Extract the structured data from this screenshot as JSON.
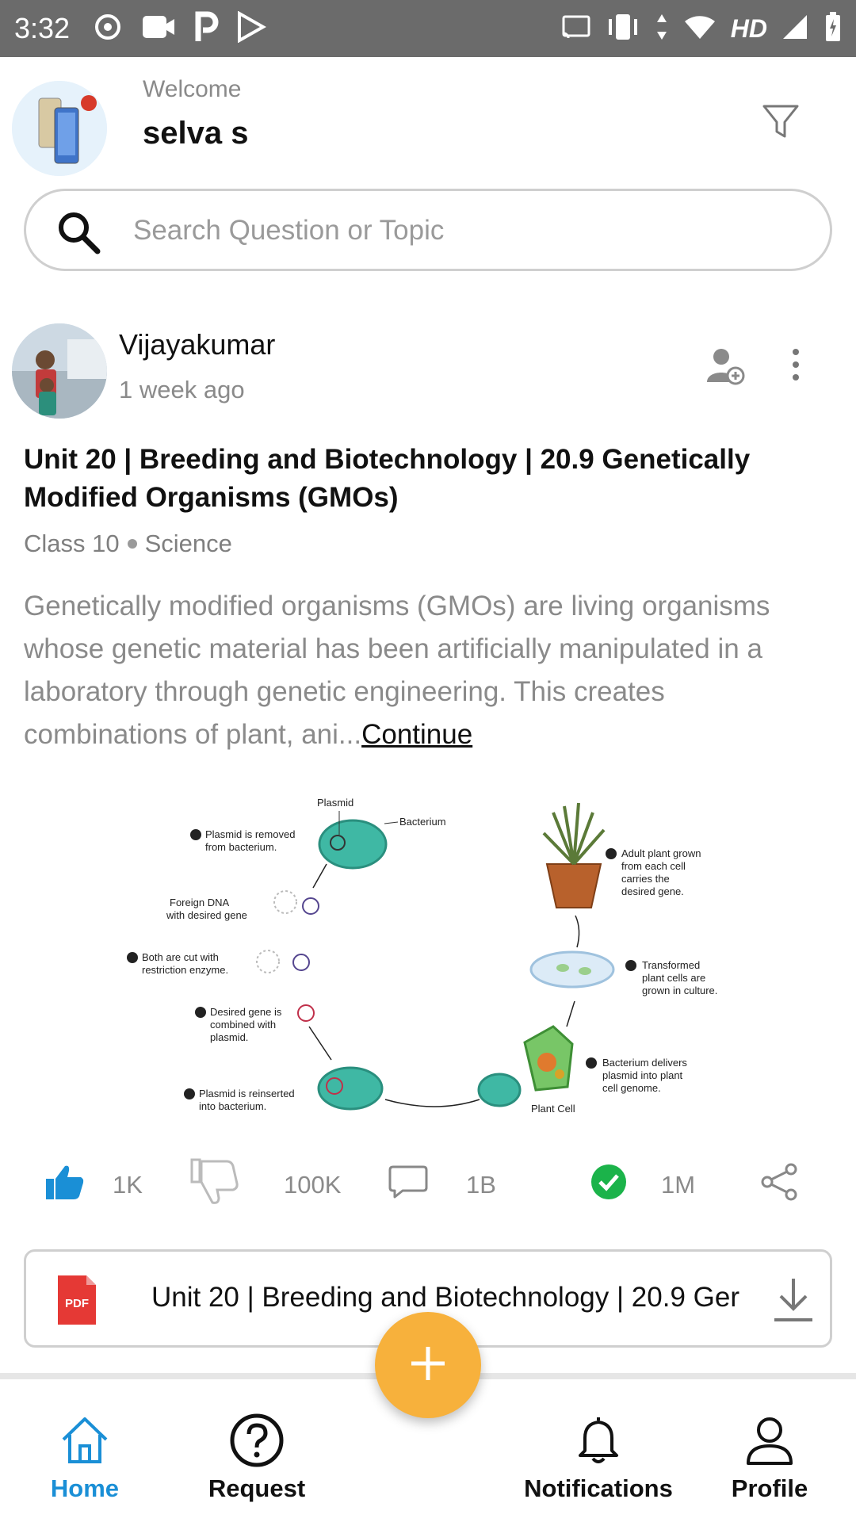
{
  "status_bar": {
    "time": "3:32",
    "hd_label": "HD",
    "left_icons": [
      "headset-icon",
      "video-icon",
      "parking-icon",
      "play-store-icon"
    ],
    "right_icons": [
      "cast-icon",
      "vibrate-icon",
      "data-arrows-icon",
      "wifi-icon",
      "signal-icon",
      "battery-icon"
    ]
  },
  "header": {
    "welcome": "Welcome",
    "username": "selva s"
  },
  "search": {
    "placeholder": "Search Question or Topic"
  },
  "post": {
    "author": "Vijayakumar",
    "time_ago": "1 week ago",
    "title": "Unit 20 | Breeding and Biotechnology | 20.9 Genetically Modified Organisms (GMOs)",
    "class_label": "Class 10",
    "subject": "Science",
    "excerpt": "Genetically modified organisms (GMOs) are living organisms whose genetic material has been artificially manipulated in a laboratory through genetic engineering. This creates combinations of plant, ani...",
    "continue_label": "Continue",
    "diagram": {
      "plasmid": "Plasmid",
      "bacterium": "Bacterium",
      "step1": "Plasmid is removed",
      "step1b": "from bacterium.",
      "foreign1": "Foreign DNA",
      "foreign2": "with desired gene",
      "step2": "Both are cut with",
      "step2b": "restriction enzyme.",
      "step3": "Desired gene is",
      "step3b": "combined with",
      "step3c": "plasmid.",
      "step4": "Plasmid is reinserted",
      "step4b": "into bacterium.",
      "step5": "Bacterium delivers",
      "step5b": "plasmid into plant",
      "step5c": "cell genome.",
      "plant_cell": "Plant Cell",
      "step6": "Transformed",
      "step6b": "plant cells are",
      "step6c": "grown in culture.",
      "step7": "Adult plant grown",
      "step7b": "from each cell",
      "step7c": "carries the",
      "step7d": "desired gene."
    },
    "likes": "1K",
    "dislikes": "100K",
    "comments": "1B",
    "answers": "1M"
  },
  "pdf": {
    "badge": "PDF",
    "name": "Unit 20 | Breeding and Biotechnology | 20.9 Ger"
  },
  "nav": {
    "home": "Home",
    "request": "Request",
    "notifications": "Notifications",
    "profile": "Profile"
  },
  "colors": {
    "accent": "#1a8fd6",
    "fab": "#f7b13c",
    "status_bar": "#6b6b6b",
    "check": "#1bb34a",
    "pdf": "#e53935"
  }
}
